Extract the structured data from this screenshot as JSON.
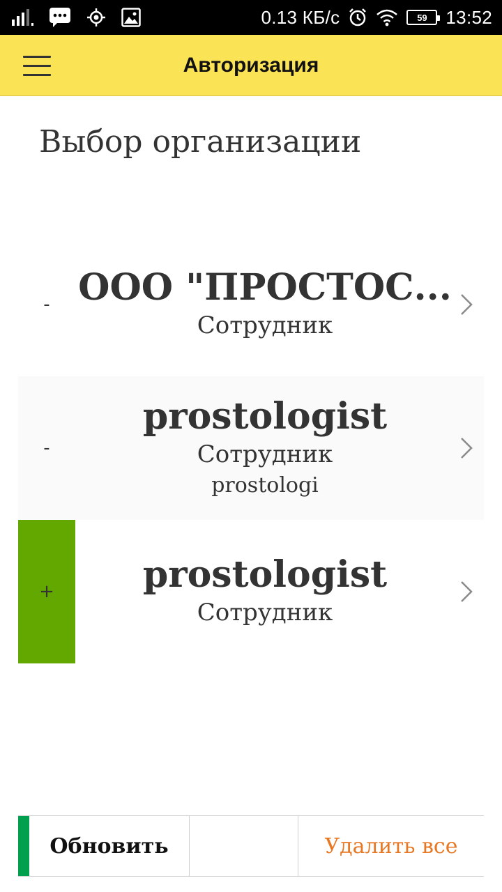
{
  "status_bar": {
    "network_speed": "0.13 КБ/с",
    "battery_level": "59",
    "time": "13:52",
    "icons": [
      "signal-icon",
      "message-icon",
      "location-icon",
      "image-icon",
      "alarm-icon",
      "wifi-icon",
      "battery-icon"
    ]
  },
  "app_bar": {
    "title": "Авторизация",
    "menu_icon": "hamburger-menu-icon",
    "background": "#fbe356"
  },
  "page": {
    "heading": "Выбор организации"
  },
  "organizations": [
    {
      "marker": "-",
      "name": "ООО \"ПРОСТОС...",
      "role": "Сотрудник",
      "extra": "",
      "selected": false
    },
    {
      "marker": "-",
      "name": "prostologist",
      "role": "Сотрудник",
      "extra": "prostologi",
      "selected": false
    },
    {
      "marker": "+",
      "name": "prostologist",
      "role": "Сотрудник",
      "extra": "",
      "selected": true
    }
  ],
  "toolbar": {
    "refresh_label": "Обновить",
    "delete_all_label": "Удалить все"
  },
  "colors": {
    "selected_marker": "#63a800",
    "toolbar_accent": "#00a04f",
    "delete_text": "#e87722"
  }
}
